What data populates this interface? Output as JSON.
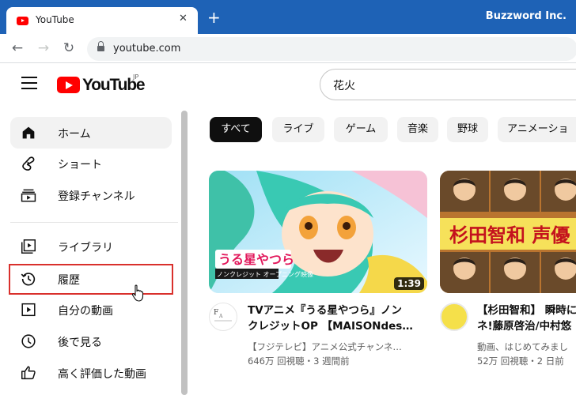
{
  "browser": {
    "tab_title": "YouTube",
    "tab_close": "✕",
    "new_tab": "+",
    "profile_name": "Buzzword Inc.",
    "back": "←",
    "forward": "→",
    "reload": "↻",
    "url": "youtube.com"
  },
  "header": {
    "logo_text": "YouTube",
    "region": "JP",
    "search_value": "花火"
  },
  "sidebar": {
    "items": [
      {
        "label": "ホーム",
        "icon": "home-icon",
        "active": true
      },
      {
        "label": "ショート",
        "icon": "shorts-icon"
      },
      {
        "label": "登録チャンネル",
        "icon": "subscriptions-icon"
      },
      {
        "label": "ライブラリ",
        "icon": "library-icon"
      },
      {
        "label": "履歴",
        "icon": "history-icon",
        "highlighted": true
      },
      {
        "label": "自分の動画",
        "icon": "your-videos-icon"
      },
      {
        "label": "後で見る",
        "icon": "watch-later-icon"
      },
      {
        "label": "高く評価した動画",
        "icon": "liked-videos-icon"
      }
    ]
  },
  "chips": [
    "すべて",
    "ライブ",
    "ゲーム",
    "音楽",
    "野球",
    "アニメーショ"
  ],
  "videos": [
    {
      "title_line1": "TVアニメ『うる星やつら』ノン",
      "title_line2": "クレジットOP 【MAISONdes…",
      "channel": "【フジテレビ】アニメ公式チャンネ…",
      "meta": "646万 回視聴・3 週間前",
      "duration": "1:39",
      "thumb_text": "うる星やつら",
      "thumb_sub": "ノンクレジット オープニング映像"
    },
    {
      "title_line1": "【杉田智和】 瞬時に",
      "title_line2": "ネ!藤原啓治/中村悠",
      "channel": "動画、はじめてみまし",
      "meta": "52万 回視聴・2 日前",
      "thumb_text": "杉田智和 声優"
    }
  ],
  "colors": {
    "browser_blue": "#1e62b6",
    "youtube_red": "#ff0000",
    "highlight_red": "#d9302c"
  }
}
